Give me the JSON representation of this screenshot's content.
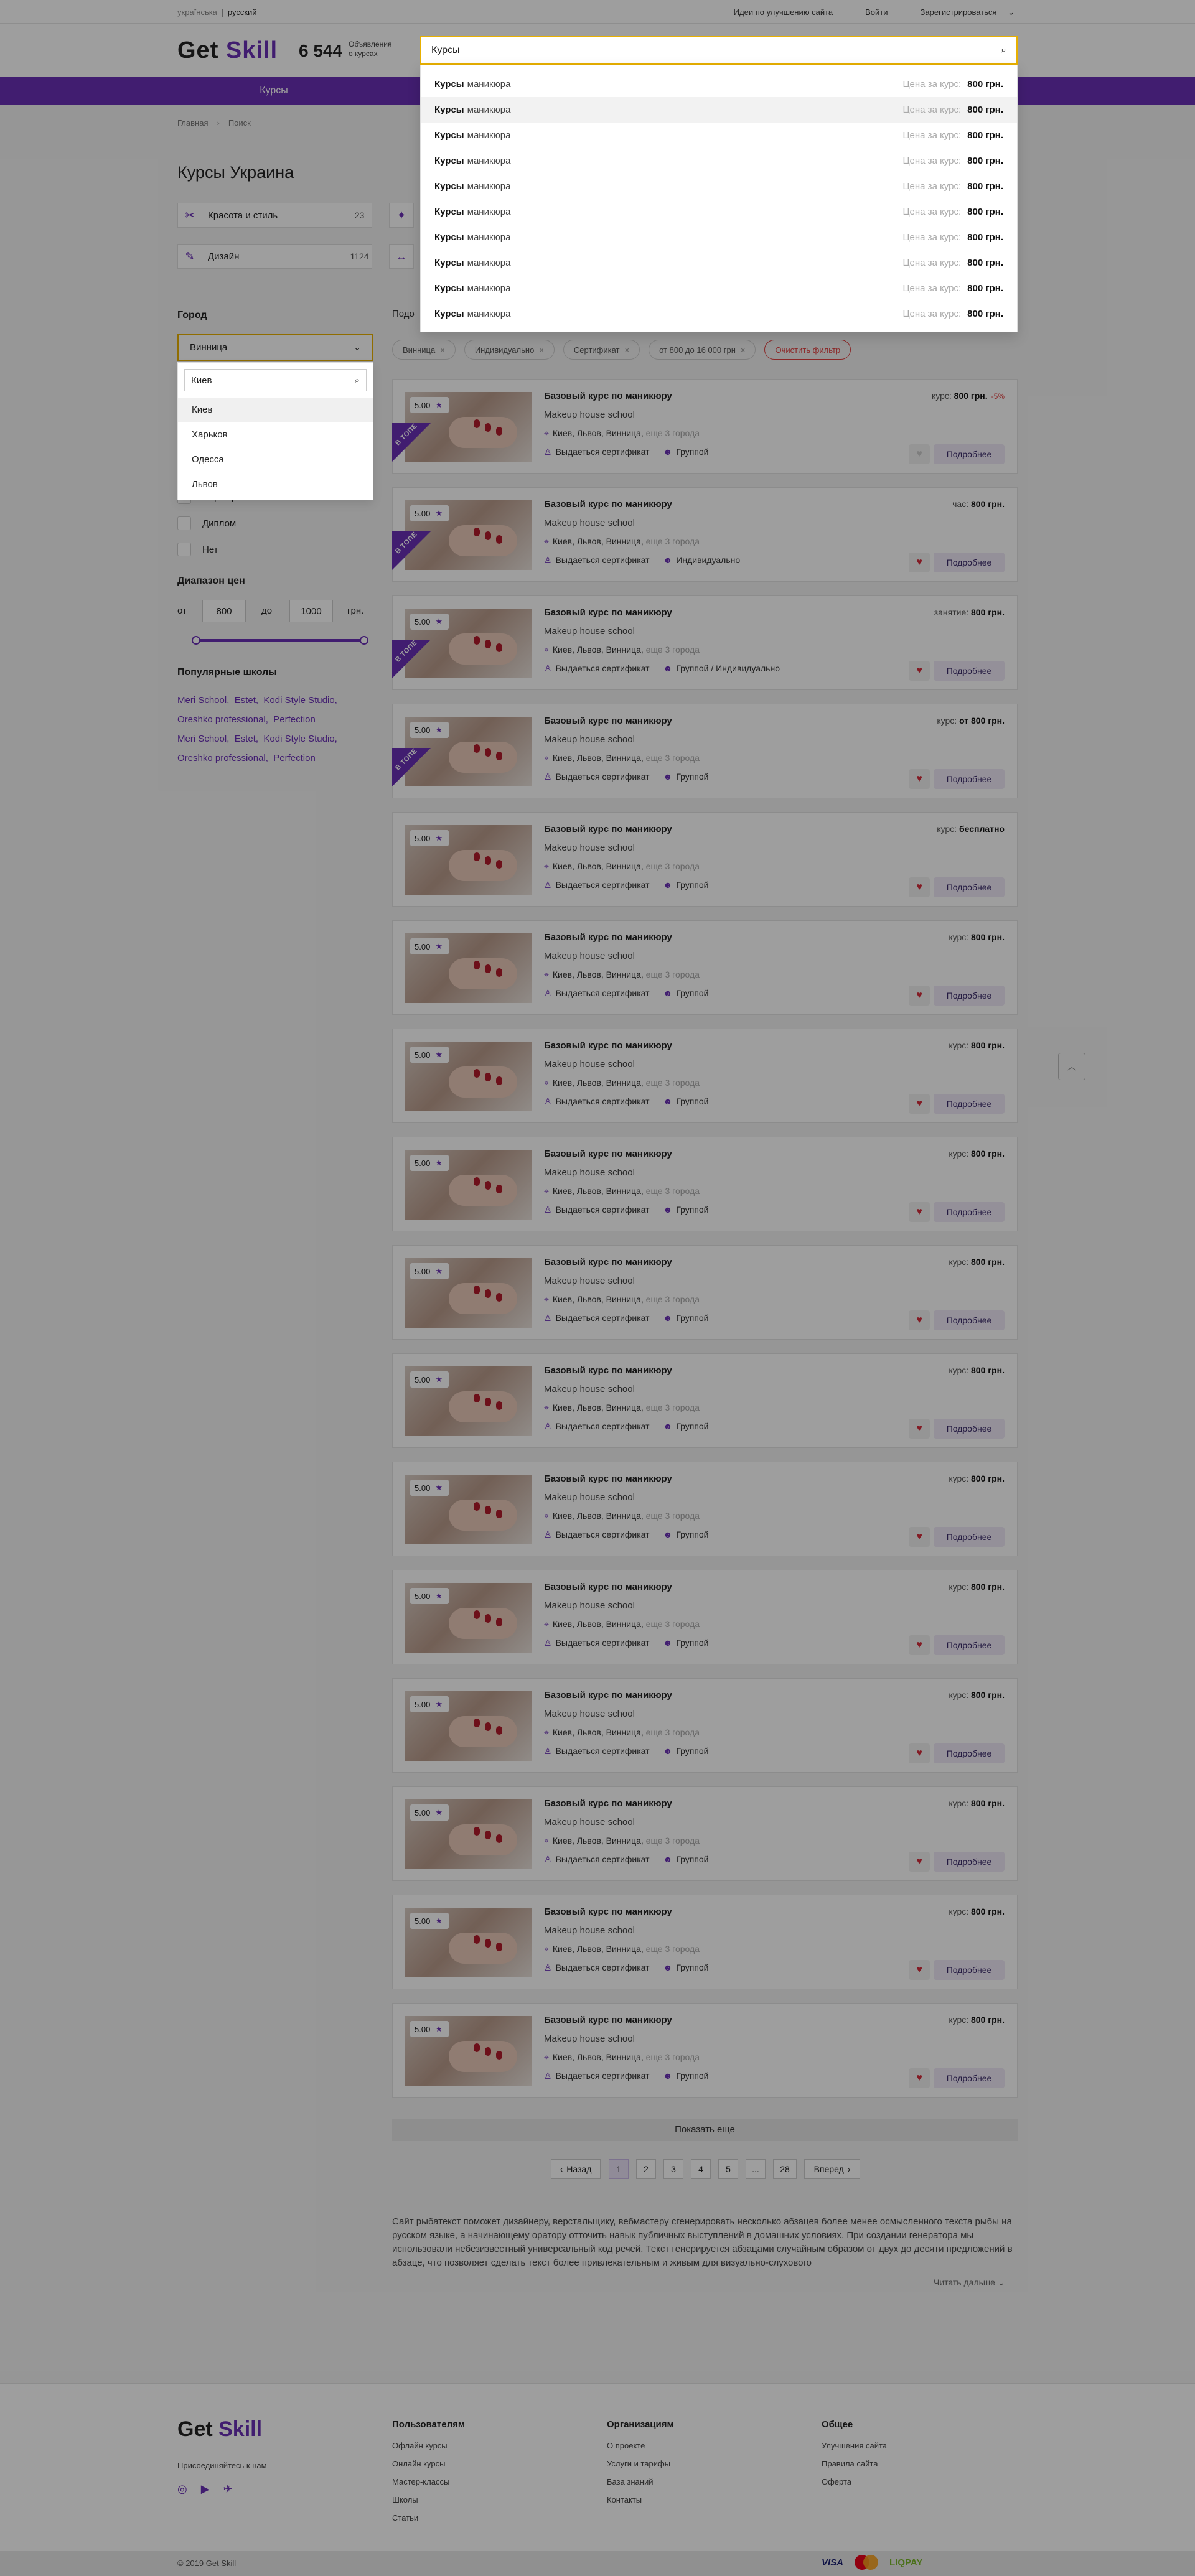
{
  "header": {
    "langs": [
      "українська",
      "русский"
    ],
    "links": [
      "Идеи по улучшению сайта",
      "Войти",
      "Зарегистрироваться"
    ],
    "logo_main": "Get ",
    "logo_accent": "Skill",
    "counter": "6 544",
    "counter_label_1": "Объявления",
    "counter_label_2": "о курсах",
    "nav_item": "Курсы"
  },
  "search": {
    "value": "Курсы",
    "suggestions": [
      {
        "q": "Курсы",
        "rest": "маникюра",
        "price_label": "Цена за курс:",
        "price": "800 грн."
      },
      {
        "q": "Курсы",
        "rest": "маникюра",
        "price_label": "Цена за курс:",
        "price": "800 грн."
      },
      {
        "q": "Курсы",
        "rest": "маникюра",
        "price_label": "Цена за курс:",
        "price": "800 грн."
      },
      {
        "q": "Курсы",
        "rest": "маникюра",
        "price_label": "Цена за курс:",
        "price": "800 грн."
      },
      {
        "q": "Курсы",
        "rest": "маникюра",
        "price_label": "Цена за курс:",
        "price": "800 грн."
      },
      {
        "q": "Курсы",
        "rest": "маникюра",
        "price_label": "Цена за курс:",
        "price": "800 грн."
      },
      {
        "q": "Курсы",
        "rest": "маникюра",
        "price_label": "Цена за курс:",
        "price": "800 грн."
      },
      {
        "q": "Курсы",
        "rest": "маникюра",
        "price_label": "Цена за курс:",
        "price": "800 грн."
      },
      {
        "q": "Курсы",
        "rest": "маникюра",
        "price_label": "Цена за курс:",
        "price": "800 грн."
      },
      {
        "q": "Курсы",
        "rest": "маникюра",
        "price_label": "Цена за курс:",
        "price": "800 грн."
      }
    ]
  },
  "breadcrumbs": [
    "Главная",
    "Поиск"
  ],
  "page_title": "Курсы Украина",
  "categories": [
    {
      "label": "Красота и стиль",
      "count": "23",
      "icon": "scissors-icon"
    },
    {
      "label": "Дизайн",
      "count": "1124",
      "icon": "brush-icon"
    }
  ],
  "sidebar": {
    "city_heading": "Город",
    "city_value": "Винница",
    "city_search_value": "Киев",
    "city_options": [
      "Киев",
      "Харьков",
      "Одесса",
      "Львов"
    ],
    "cert_options": [
      "Сертификат",
      "Диплом",
      "Нет"
    ],
    "price_heading": "Диапазон цен",
    "price_from_label": "от",
    "price_from": "800",
    "price_to_label": "до",
    "price_to": "1000",
    "price_unit": "грн.",
    "schools_heading": "Популярные школы",
    "schools": [
      "Meri School,",
      "Estet,",
      "Kodi Style Studio,",
      "Oreshko professional,",
      "Perfection",
      "Meri School,",
      "Estet,",
      "Kodi Style Studio,",
      "Oreshko professional,",
      "Perfection"
    ]
  },
  "filters": {
    "sort_label": "Подо",
    "chips": [
      "Винница",
      "Индивидуально",
      "Сертификат",
      "от 800 до 16 000 грн"
    ],
    "clear_label": "Очистить фильтр"
  },
  "cards": [
    {
      "rating": "5.00",
      "top": true,
      "title": "Базовый курс по маникюру",
      "school": "Makeup house school",
      "cities": "Киев, Львов, Винница,",
      "more": "еще 3 города",
      "cert": "Выдаеться сертификат",
      "format": "Группой",
      "unit": "курс:",
      "price": "800 грн.",
      "discount": "-5%",
      "liked": false,
      "btn": "Подробнее"
    },
    {
      "rating": "5.00",
      "top": true,
      "title": "Базовый курс по маникюру",
      "school": "Makeup house school",
      "cities": "Киев, Львов, Винница,",
      "more": "еще 3 города",
      "cert": "Выдаеться сертификат",
      "format": "Индивидуально",
      "unit": "час:",
      "price": "800 грн.",
      "discount": "",
      "liked": true,
      "btn": "Подробнее"
    },
    {
      "rating": "5.00",
      "top": true,
      "title": "Базовый курс по маникюру",
      "school": "Makeup house school",
      "cities": "Киев, Львов, Винница,",
      "more": "еще 3 города",
      "cert": "Выдаеться сертификат",
      "format": "Группой / Индивидуально",
      "unit": "занятие:",
      "price": "800 грн.",
      "discount": "",
      "liked": true,
      "btn": "Подробнее"
    },
    {
      "rating": "5.00",
      "top": true,
      "title": "Базовый курс по маникюру",
      "school": "Makeup house school",
      "cities": "Киев, Львов, Винница,",
      "more": "еще 3 города",
      "cert": "Выдаеться сертификат",
      "format": "Группой",
      "unit": "курс:",
      "price": "от 800 грн.",
      "discount": "",
      "liked": true,
      "btn": "Подробнее"
    },
    {
      "rating": "5.00",
      "top": false,
      "title": "Базовый курс по маникюру",
      "school": "Makeup house school",
      "cities": "Киев, Львов, Винница,",
      "more": "еще 3 города",
      "cert": "Выдаеться сертификат",
      "format": "Группой",
      "unit": "курс:",
      "price": "бесплатно",
      "discount": "",
      "liked": true,
      "btn": "Подробнее"
    },
    {
      "rating": "5.00",
      "top": false,
      "title": "Базовый курс по маникюру",
      "school": "Makeup house school",
      "cities": "Киев, Львов, Винница,",
      "more": "еще 3 города",
      "cert": "Выдаеться сертификат",
      "format": "Группой",
      "unit": "курс:",
      "price": "800 грн.",
      "discount": "",
      "liked": true,
      "btn": "Подробнее"
    },
    {
      "rating": "5.00",
      "top": false,
      "title": "Базовый курс по маникюру",
      "school": "Makeup house school",
      "cities": "Киев, Львов, Винница,",
      "more": "еще 3 города",
      "cert": "Выдаеться сертификат",
      "format": "Группой",
      "unit": "курс:",
      "price": "800 грн.",
      "discount": "",
      "liked": true,
      "btn": "Подробнее"
    },
    {
      "rating": "5.00",
      "top": false,
      "title": "Базовый курс по маникюру",
      "school": "Makeup house school",
      "cities": "Киев, Львов, Винница,",
      "more": "еще 3 города",
      "cert": "Выдаеться сертификат",
      "format": "Группой",
      "unit": "курс:",
      "price": "800 грн.",
      "discount": "",
      "liked": true,
      "btn": "Подробнее"
    },
    {
      "rating": "5.00",
      "top": false,
      "title": "Базовый курс по маникюру",
      "school": "Makeup house school",
      "cities": "Киев, Львов, Винница,",
      "more": "еще 3 города",
      "cert": "Выдаеться сертификат",
      "format": "Группой",
      "unit": "курс:",
      "price": "800 грн.",
      "discount": "",
      "liked": true,
      "btn": "Подробнее"
    },
    {
      "rating": "5.00",
      "top": false,
      "title": "Базовый курс по маникюру",
      "school": "Makeup house school",
      "cities": "Киев, Львов, Винница,",
      "more": "еще 3 города",
      "cert": "Выдаеться сертификат",
      "format": "Группой",
      "unit": "курс:",
      "price": "800 грн.",
      "discount": "",
      "liked": true,
      "btn": "Подробнее"
    },
    {
      "rating": "5.00",
      "top": false,
      "title": "Базовый курс по маникюру",
      "school": "Makeup house school",
      "cities": "Киев, Львов, Винница,",
      "more": "еще 3 города",
      "cert": "Выдаеться сертификат",
      "format": "Группой",
      "unit": "курс:",
      "price": "800 грн.",
      "discount": "",
      "liked": true,
      "btn": "Подробнее"
    },
    {
      "rating": "5.00",
      "top": false,
      "title": "Базовый курс по маникюру",
      "school": "Makeup house school",
      "cities": "Киев, Львов, Винница,",
      "more": "еще 3 города",
      "cert": "Выдаеться сертификат",
      "format": "Группой",
      "unit": "курс:",
      "price": "800 грн.",
      "discount": "",
      "liked": true,
      "btn": "Подробнее"
    },
    {
      "rating": "5.00",
      "top": false,
      "title": "Базовый курс по маникюру",
      "school": "Makeup house school",
      "cities": "Киев, Львов, Винница,",
      "more": "еще 3 города",
      "cert": "Выдаеться сертификат",
      "format": "Группой",
      "unit": "курс:",
      "price": "800 грн.",
      "discount": "",
      "liked": true,
      "btn": "Подробнее"
    },
    {
      "rating": "5.00",
      "top": false,
      "title": "Базовый курс по маникюру",
      "school": "Makeup house school",
      "cities": "Киев, Львов, Винница,",
      "more": "еще 3 города",
      "cert": "Выдаеться сертификат",
      "format": "Группой",
      "unit": "курс:",
      "price": "800 грн.",
      "discount": "",
      "liked": true,
      "btn": "Подробнее"
    },
    {
      "rating": "5.00",
      "top": false,
      "title": "Базовый курс по маникюру",
      "school": "Makeup house school",
      "cities": "Киев, Львов, Винница,",
      "more": "еще 3 города",
      "cert": "Выдаеться сертификат",
      "format": "Группой",
      "unit": "курс:",
      "price": "800 грн.",
      "discount": "",
      "liked": true,
      "btn": "Подробнее"
    },
    {
      "rating": "5.00",
      "top": false,
      "title": "Базовый курс по маникюру",
      "school": "Makeup house school",
      "cities": "Киев, Львов, Винница,",
      "more": "еще 3 города",
      "cert": "Выдаеться сертификат",
      "format": "Группой",
      "unit": "курс:",
      "price": "800 грн.",
      "discount": "",
      "liked": true,
      "btn": "Подробнее"
    }
  ],
  "ribbon_text": "В ТОПЕ",
  "show_more": "Показать еще",
  "pagination": {
    "prev": "Назад",
    "pages": [
      "1",
      "2",
      "3",
      "4",
      "5",
      "...",
      "28"
    ],
    "next": "Вперед"
  },
  "seo_text": "Сайт рыбатекст поможет дизайнеру, верстальщику, вебмастеру сгенерировать несколько абзацев более менее осмысленного текста рыбы на русском языке, а начинающему оратору отточить навык публичных выступлений в домашних условиях. При создании генератора мы использовали небезизвестный универсальный код речей. Текст генерируется абзацами случайным образом от двух до десяти предложений в абзаце, что позволяет сделать текст более привлекательным и живым для визуально-слухового",
  "read_more": "Читать дальше",
  "footer": {
    "logo_main": "Get ",
    "logo_accent": "Skill",
    "join": "Присоединяйтесь к нам",
    "cols": [
      {
        "title": "Пользователям",
        "links": [
          "Офлайн курсы",
          "Онлайн курсы",
          "Мастер-классы",
          "Школы",
          "Статьи"
        ]
      },
      {
        "title": "Организациям",
        "links": [
          "О проекте",
          "Услуги и тарифы",
          "База знаний",
          "Контакты"
        ]
      },
      {
        "title": "Общее",
        "links": [
          "Улучшения сайта",
          "Правила сайта",
          "Оферта"
        ]
      }
    ],
    "copyright": "© 2019 Get Skill",
    "pay_visa": "VISA",
    "pay_liqpay": "LIQPAY"
  }
}
